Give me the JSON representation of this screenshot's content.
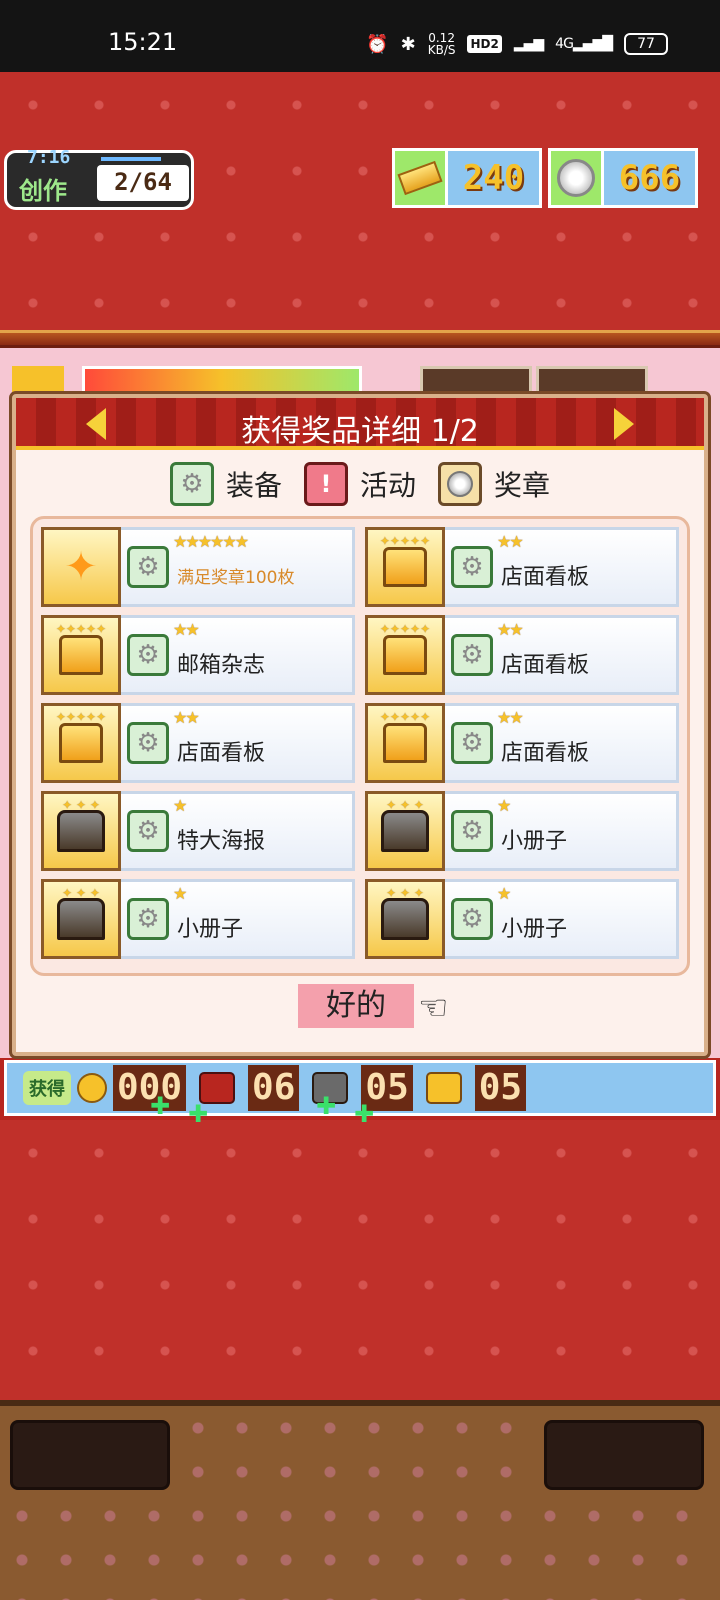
{
  "status_bar": {
    "time": "15:21",
    "net_speed_value": "0.12",
    "net_speed_unit": "KB/S",
    "hd": "HD2",
    "signal": "4G",
    "battery": "77"
  },
  "hud": {
    "timer": "7:16",
    "create_label": "创作",
    "create_count": "2/64",
    "gold": "240",
    "medals": "666"
  },
  "dialog": {
    "title": "获得奖品详细 1/2",
    "legend": {
      "equip": "装备",
      "event": "活动",
      "medal": "奖章"
    },
    "items": [
      {
        "name": "满足奖章100枚",
        "rank": "★★★★★★",
        "thumb": "sparkle",
        "highlight": true
      },
      {
        "name": "店面看板",
        "rank": "★★",
        "thumb": "gold-chest"
      },
      {
        "name": "邮箱杂志",
        "rank": "★★",
        "thumb": "gold-chest"
      },
      {
        "name": "店面看板",
        "rank": "★★",
        "thumb": "gold-chest"
      },
      {
        "name": "店面看板",
        "rank": "★★",
        "thumb": "gold-chest"
      },
      {
        "name": "店面看板",
        "rank": "★★",
        "thumb": "gold-chest"
      },
      {
        "name": "特大海报",
        "rank": "★",
        "thumb": "dark-chest"
      },
      {
        "name": "小册子",
        "rank": "★",
        "thumb": "dark-chest"
      },
      {
        "name": "小册子",
        "rank": "★",
        "thumb": "dark-chest"
      },
      {
        "name": "小册子",
        "rank": "★",
        "thumb": "dark-chest"
      }
    ],
    "ok_label": "好的"
  },
  "acquired_bar": {
    "label": "获得",
    "coins": "000",
    "red_chests": "06",
    "silver_chests": "05",
    "gold_chests": "05"
  },
  "colors": {
    "header_red": "#b8261f",
    "value_yellow": "#f6c12a",
    "panel_pink": "#fdf1ec",
    "ok_pink": "#f4a0ac"
  }
}
